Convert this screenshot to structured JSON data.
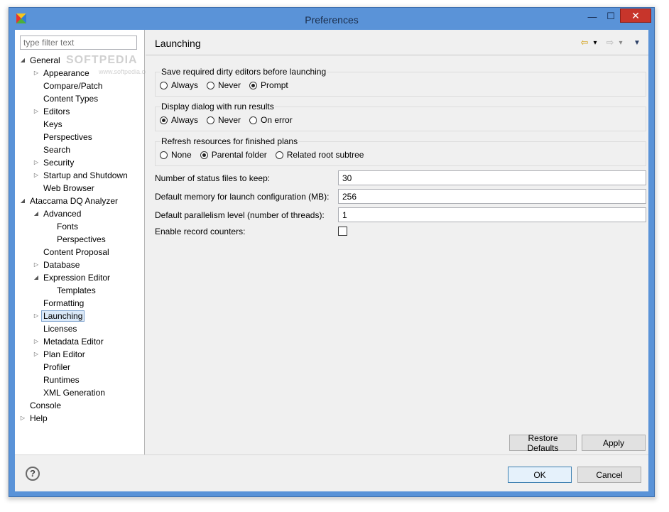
{
  "window": {
    "title": "Preferences",
    "minimize_glyph": "—",
    "maximize_glyph": "☐",
    "close_glyph": "✕"
  },
  "sidebar": {
    "filter_placeholder": "type filter text",
    "selected": "Launching",
    "items": [
      {
        "label": "General",
        "level": 0,
        "expander": "open"
      },
      {
        "label": "Appearance",
        "level": 1,
        "expander": "closed"
      },
      {
        "label": "Compare/Patch",
        "level": 1,
        "expander": "none"
      },
      {
        "label": "Content Types",
        "level": 1,
        "expander": "none"
      },
      {
        "label": "Editors",
        "level": 1,
        "expander": "closed"
      },
      {
        "label": "Keys",
        "level": 1,
        "expander": "none"
      },
      {
        "label": "Perspectives",
        "level": 1,
        "expander": "none"
      },
      {
        "label": "Search",
        "level": 1,
        "expander": "none"
      },
      {
        "label": "Security",
        "level": 1,
        "expander": "closed"
      },
      {
        "label": "Startup and Shutdown",
        "level": 1,
        "expander": "closed"
      },
      {
        "label": "Web Browser",
        "level": 1,
        "expander": "none"
      },
      {
        "label": "Ataccama DQ Analyzer",
        "level": 0,
        "expander": "open"
      },
      {
        "label": "Advanced",
        "level": 1,
        "expander": "open"
      },
      {
        "label": "Fonts",
        "level": 2,
        "expander": "none"
      },
      {
        "label": "Perspectives",
        "level": 2,
        "expander": "none"
      },
      {
        "label": "Content Proposal",
        "level": 1,
        "expander": "none"
      },
      {
        "label": "Database",
        "level": 1,
        "expander": "closed"
      },
      {
        "label": "Expression Editor",
        "level": 1,
        "expander": "open"
      },
      {
        "label": "Templates",
        "level": 2,
        "expander": "none"
      },
      {
        "label": "Formatting",
        "level": 1,
        "expander": "none"
      },
      {
        "label": "Launching",
        "level": 1,
        "expander": "closed"
      },
      {
        "label": "Licenses",
        "level": 1,
        "expander": "none"
      },
      {
        "label": "Metadata Editor",
        "level": 1,
        "expander": "closed"
      },
      {
        "label": "Plan Editor",
        "level": 1,
        "expander": "closed"
      },
      {
        "label": "Profiler",
        "level": 1,
        "expander": "none"
      },
      {
        "label": "Runtimes",
        "level": 1,
        "expander": "none"
      },
      {
        "label": "XML Generation",
        "level": 1,
        "expander": "none"
      },
      {
        "label": "Console",
        "level": 0,
        "expander": "none"
      },
      {
        "label": "Help",
        "level": 0,
        "expander": "closed"
      }
    ]
  },
  "watermark": {
    "text": "SOFTPEDIA",
    "sub": "www.softpedia.com"
  },
  "page": {
    "title": "Launching",
    "nav": {
      "back": "⇦",
      "back_menu": "▾",
      "forward": "⇨",
      "forward_menu": "▾",
      "view_menu": "▼"
    },
    "groups": [
      {
        "title": "Save required dirty editors before launching",
        "options": [
          "Always",
          "Never",
          "Prompt"
        ],
        "selected": 2
      },
      {
        "title": "Display dialog with run results",
        "options": [
          "Always",
          "Never",
          "On error"
        ],
        "selected": 0
      },
      {
        "title": "Refresh resources for finished plans",
        "options": [
          "None",
          "Parental folder",
          "Related root subtree"
        ],
        "selected": 1
      }
    ],
    "fields": [
      {
        "label": "Number of status files to keep:",
        "value": "30"
      },
      {
        "label": "Default memory for launch configuration (MB):",
        "value": "256"
      },
      {
        "label": "Default parallelism level (number of threads):",
        "value": "1"
      }
    ],
    "checkbox": {
      "label": "Enable record counters:",
      "checked": false
    },
    "restore_defaults": "Restore Defaults",
    "apply": "Apply"
  },
  "footer": {
    "help_glyph": "?",
    "ok": "OK",
    "cancel": "Cancel"
  },
  "colors": {
    "frame": "#5a93d8",
    "close": "#c7352b",
    "selection": "#dbe9f8"
  }
}
